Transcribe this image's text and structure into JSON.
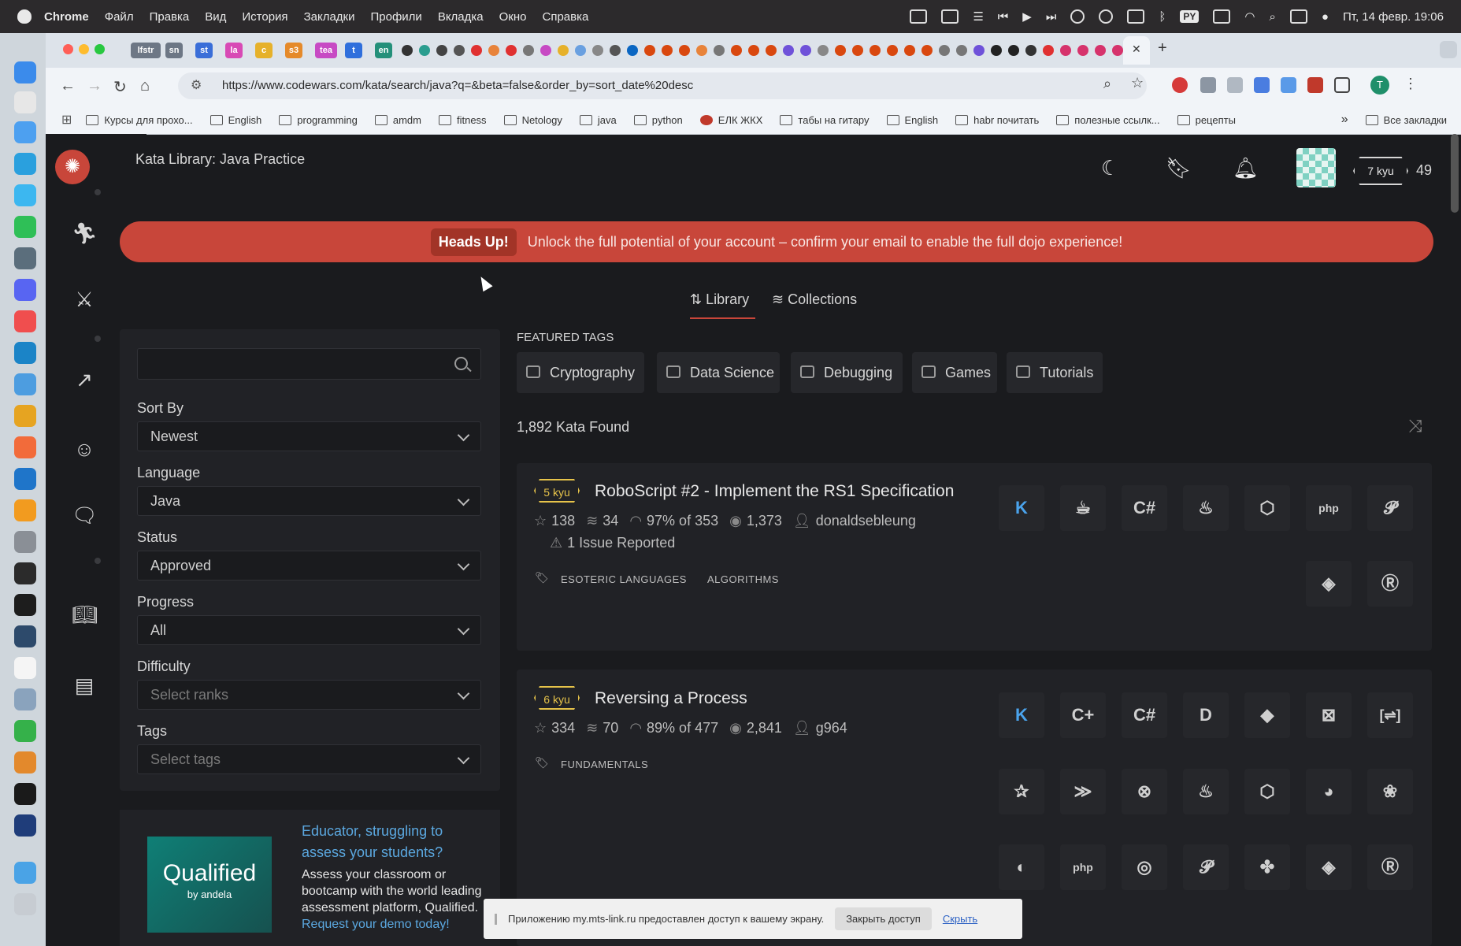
{
  "menubar": {
    "app": "Chrome",
    "items": [
      "Файл",
      "Правка",
      "Вид",
      "История",
      "Закладки",
      "Профили",
      "Вкладка",
      "Окно",
      "Справка"
    ],
    "kbd": "PY",
    "datetime": "Пт, 14 февр. 19:06"
  },
  "tabs": {
    "pinned": [
      "lfstr",
      "sn",
      "st",
      "la",
      "c",
      "s3",
      "tea",
      "t",
      "en"
    ],
    "close": "✕",
    "new_tab": "+"
  },
  "address": {
    "url": "https://www.codewars.com/kata/search/java?q=&beta=false&order_by=sort_date%20desc",
    "profile_initial": "T"
  },
  "bookmarks": {
    "items": [
      "Курсы для прохо...",
      "English",
      "programming",
      "amdm",
      "fitness",
      "Netology",
      "java",
      "python",
      "ЕЛК ЖКХ",
      "табы на гитару",
      "English",
      "habr почитать",
      "полезные ссылк...",
      "рецепты"
    ],
    "more": "»",
    "all": "Все закладки"
  },
  "header": {
    "title": "Kata Library: Java Practice",
    "rank": "7 kyu",
    "honor": "49"
  },
  "banner": {
    "pill": "Heads Up!",
    "message": "Unlock the full potential of your account – confirm your email to enable the full dojo experience!"
  },
  "page_tabs": {
    "library": "Library",
    "collections": "Collections"
  },
  "filters": {
    "search_placeholder": "",
    "sort_label": "Sort By",
    "sort_value": "Newest",
    "language_label": "Language",
    "language_value": "Java",
    "status_label": "Status",
    "status_value": "Approved",
    "progress_label": "Progress",
    "progress_value": "All",
    "difficulty_label": "Difficulty",
    "difficulty_placeholder": "Select ranks",
    "tags_label": "Tags",
    "tags_placeholder": "Select tags"
  },
  "ad": {
    "logo": "Qualified",
    "logo_sub": "by andela",
    "title": "Educator, struggling to assess your students?",
    "body": "Assess your classroom or bootcamp with the world leading assessment platform, Qualified.",
    "link": "Request your demo today!"
  },
  "featured": {
    "title": "FEATURED TAGS",
    "tags": [
      "Cryptography",
      "Data Science",
      "Debugging",
      "Games",
      "Tutorials"
    ]
  },
  "results": {
    "count": "1,892 Kata Found"
  },
  "katas": [
    {
      "kyu": "5 kyu",
      "title": "RoboScript #2 - Implement the RS1 Specification",
      "stars": "138",
      "collections": "34",
      "satisfaction": "97% of 353",
      "completed": "1,373",
      "author": "donaldsebleung",
      "issues": "1 Issue Reported",
      "tags": [
        "ESOTERIC LANGUAGES",
        "ALGORITHMS"
      ],
      "languages": [
        "kotlin-icon",
        "coffeescript-icon",
        "csharp-icon",
        "java-icon",
        "javascript-icon",
        "php-icon",
        "python-icon",
        "ruby-icon",
        "rust-icon"
      ]
    },
    {
      "kyu": "6 kyu",
      "title": "Reversing a Process",
      "stars": "334",
      "collections": "70",
      "satisfaction": "89% of 477",
      "completed": "2,841",
      "author": "g964",
      "tags": [
        "FUNDAMENTALS"
      ],
      "languages": [
        "kotlin-icon",
        "cpp-icon",
        "csharp-icon",
        "d-icon",
        "dart-icon",
        "elixir-icon",
        "fsharp-icon",
        "crystal-icon",
        "haskell-icon",
        "clojure-icon",
        "java-icon",
        "javascript-icon",
        "julia-icon",
        "nim-icon",
        "ocaml-icon",
        "php-icon",
        "powershell-icon",
        "python-icon",
        "racket-icon",
        "ruby-icon",
        "rust-icon"
      ]
    }
  ],
  "toast": {
    "message": "Приложению my.mts-link.ru предоставлен доступ к вашему экрану.",
    "stop": "Закрыть доступ",
    "hide": "Скрыть"
  }
}
